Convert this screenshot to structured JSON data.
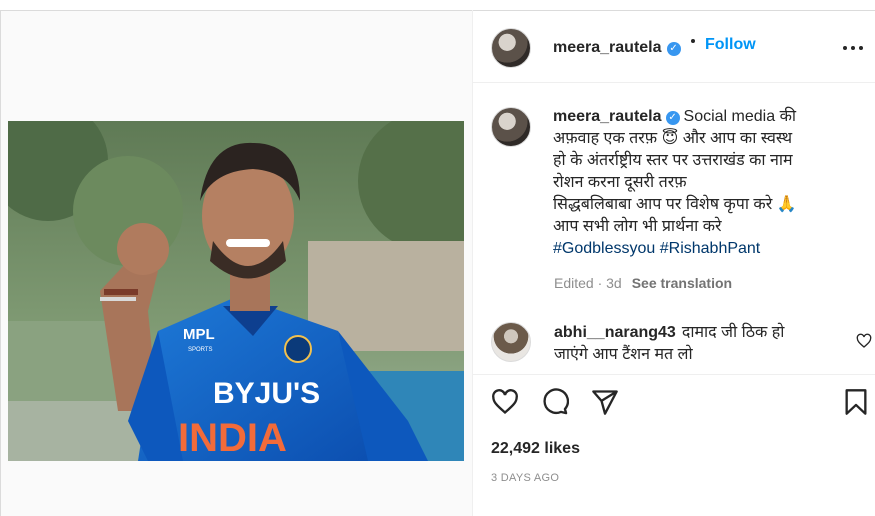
{
  "post": {
    "username": "meera_rautela",
    "follow_label": "Follow",
    "verified_mark": "✓",
    "caption": {
      "line_1": "Social media की",
      "line_2": "अफ़वाह एक तरफ़ 😇 और आप का स्वस्थ",
      "line_3": "हो के अंतर्राष्ट्रीय स्तर पर उत्तराखंड का नाम",
      "line_4": "रोशन करना दूसरी तरफ़",
      "line_5": "सिद्धबलिबाबा आप पर विशेष कृपा करे 🙏",
      "line_6": "आप सभी लोग भी प्रार्थना करे",
      "hashtags": "#Godblessyou #RishabhPant"
    },
    "edited_label": "Edited · 3d",
    "see_translation": "See translation",
    "likes": "22,492 likes",
    "time_ago": "3 DAYS AGO"
  },
  "comment": {
    "username": "abhi__narang43",
    "text_1": "दामाद जी ठिक हो",
    "text_2": "जाएंगे आप टैंशन मत लो"
  },
  "photo": {
    "jersey_brand": "MPL",
    "jersey_brand_sub": "SPORTS",
    "sponsor": "BYJU'S",
    "country": "INDIA"
  },
  "icons": {
    "more": "more-options-icon",
    "like": "heart-icon",
    "comment": "comment-icon",
    "share": "share-icon",
    "save": "bookmark-icon"
  }
}
